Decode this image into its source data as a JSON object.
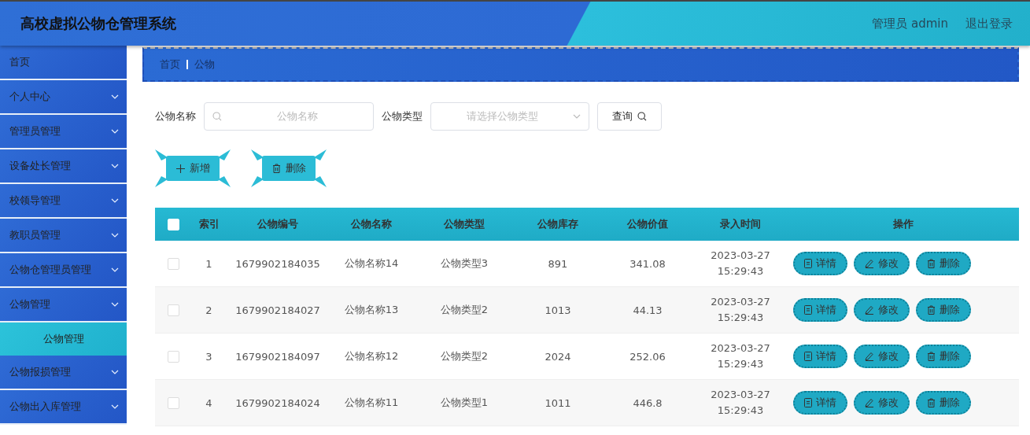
{
  "header": {
    "title": "高校虚拟公物仓管理系统",
    "user": "管理员 admin",
    "logout": "退出登录"
  },
  "sidebar": {
    "items": [
      {
        "label": "首页",
        "kind": "link"
      },
      {
        "label": "个人中心",
        "kind": "menu"
      },
      {
        "label": "管理员管理",
        "kind": "menu"
      },
      {
        "label": "设备处长管理",
        "kind": "menu"
      },
      {
        "label": "校领导管理",
        "kind": "menu"
      },
      {
        "label": "教职员管理",
        "kind": "menu"
      },
      {
        "label": "公物仓管理员管理",
        "kind": "menu"
      },
      {
        "label": "公物管理",
        "kind": "menu",
        "children": [
          {
            "label": "公物管理",
            "selected": true
          }
        ]
      },
      {
        "label": "公物报损管理",
        "kind": "menu"
      },
      {
        "label": "公物出入库管理",
        "kind": "menu"
      }
    ]
  },
  "breadcrumb": [
    "首页",
    "公物"
  ],
  "search": {
    "fields": [
      {
        "label": "公物名称",
        "kind": "text",
        "placeholder": "公物名称"
      },
      {
        "label": "公物类型",
        "kind": "select",
        "placeholder": "请选择公物类型"
      }
    ],
    "button": "查询"
  },
  "actions": [
    {
      "label": "新增",
      "kind": "add"
    },
    {
      "label": "删除",
      "kind": "delete"
    }
  ],
  "table": {
    "select_all": {
      "checked": false
    },
    "columns": [
      "索引",
      "公物编号",
      "公物名称",
      "公物类型",
      "公物库存",
      "公物价值",
      "录入时间",
      "操作"
    ],
    "rows": [
      {
        "checked": false,
        "cells": [
          "1",
          "1679902184035",
          "公物名称14",
          "公物类型3",
          "891",
          "341.08",
          "2023-03-27 15:29:43"
        ],
        "buttons": [
          {
            "label": "详情",
            "kind": "detail"
          },
          {
            "label": "修改",
            "kind": "edit"
          },
          {
            "label": "删除",
            "kind": "delete"
          }
        ]
      },
      {
        "checked": false,
        "cells": [
          "2",
          "1679902184027",
          "公物名称13",
          "公物类型2",
          "1013",
          "44.13",
          "2023-03-27 15:29:43"
        ],
        "buttons": [
          {
            "label": "详情",
            "kind": "detail"
          },
          {
            "label": "修改",
            "kind": "edit"
          },
          {
            "label": "删除",
            "kind": "delete"
          }
        ]
      },
      {
        "checked": false,
        "cells": [
          "3",
          "1679902184097",
          "公物名称12",
          "公物类型2",
          "2024",
          "252.06",
          "2023-03-27 15:29:43"
        ],
        "buttons": [
          {
            "label": "详情",
            "kind": "detail"
          },
          {
            "label": "修改",
            "kind": "edit"
          },
          {
            "label": "删除",
            "kind": "delete"
          }
        ]
      },
      {
        "checked": false,
        "cells": [
          "4",
          "1679902184024",
          "公物名称11",
          "公物类型1",
          "1011",
          "446.8",
          "2023-03-27 15:29:43"
        ],
        "buttons": [
          {
            "label": "详情",
            "kind": "detail"
          },
          {
            "label": "修改",
            "kind": "edit"
          },
          {
            "label": "删除",
            "kind": "delete"
          }
        ]
      }
    ]
  }
}
